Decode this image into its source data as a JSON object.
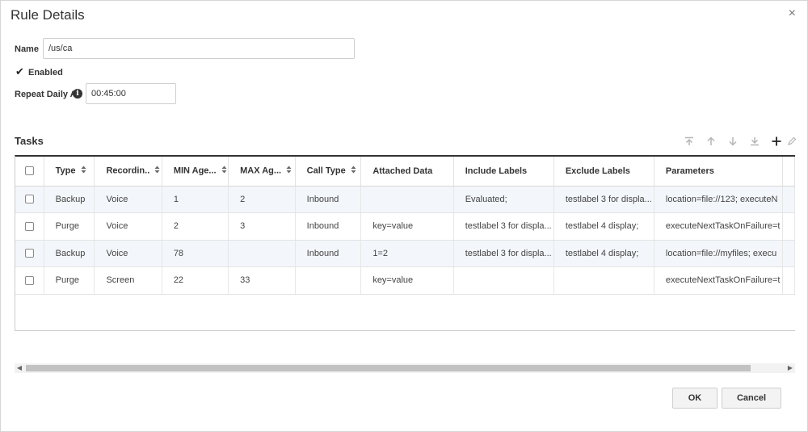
{
  "dialog": {
    "title": "Rule Details",
    "close": "×"
  },
  "form": {
    "name_label": "Name",
    "name_value": "/us/ca",
    "enabled_label": "Enabled",
    "enabled_checked": true,
    "repeat_label": "Repeat Daily At:",
    "repeat_value": "00:45:00"
  },
  "tasks": {
    "title": "Tasks",
    "toolbar": [
      "move-to-top-icon",
      "move-up-icon",
      "move-down-icon",
      "move-to-bottom-icon",
      "plus-icon",
      "pencil-icon"
    ],
    "columns": [
      {
        "label": "Type",
        "sortable": true
      },
      {
        "label": "Recordin..",
        "sortable": true
      },
      {
        "label": "MIN Age...",
        "sortable": true
      },
      {
        "label": "MAX Ag...",
        "sortable": true
      },
      {
        "label": "Call Type",
        "sortable": true
      },
      {
        "label": "Attached Data",
        "sortable": false
      },
      {
        "label": "Include Labels",
        "sortable": false
      },
      {
        "label": "Exclude Labels",
        "sortable": false
      },
      {
        "label": "Parameters",
        "sortable": false
      }
    ],
    "rows": [
      [
        "Backup",
        "Voice",
        "1",
        "2",
        "Inbound",
        "",
        "Evaluated;",
        "testlabel 3 for displa...",
        "location=file://123; executeN"
      ],
      [
        "Purge",
        "Voice",
        "2",
        "3",
        "Inbound",
        "key=value",
        "testlabel 3 for displa...",
        "testlabel 4 display;",
        "executeNextTaskOnFailure=t"
      ],
      [
        "Backup",
        "Voice",
        "78",
        "",
        "Inbound",
        "1=2",
        "testlabel 3 for displa...",
        "testlabel 4 display;",
        "location=file://myfiles; execu"
      ],
      [
        "Purge",
        "Screen",
        "22",
        "33",
        "",
        "key=value",
        "",
        "",
        "executeNextTaskOnFailure=t"
      ]
    ]
  },
  "footer": {
    "ok_label": "OK",
    "cancel_label": "Cancel"
  }
}
